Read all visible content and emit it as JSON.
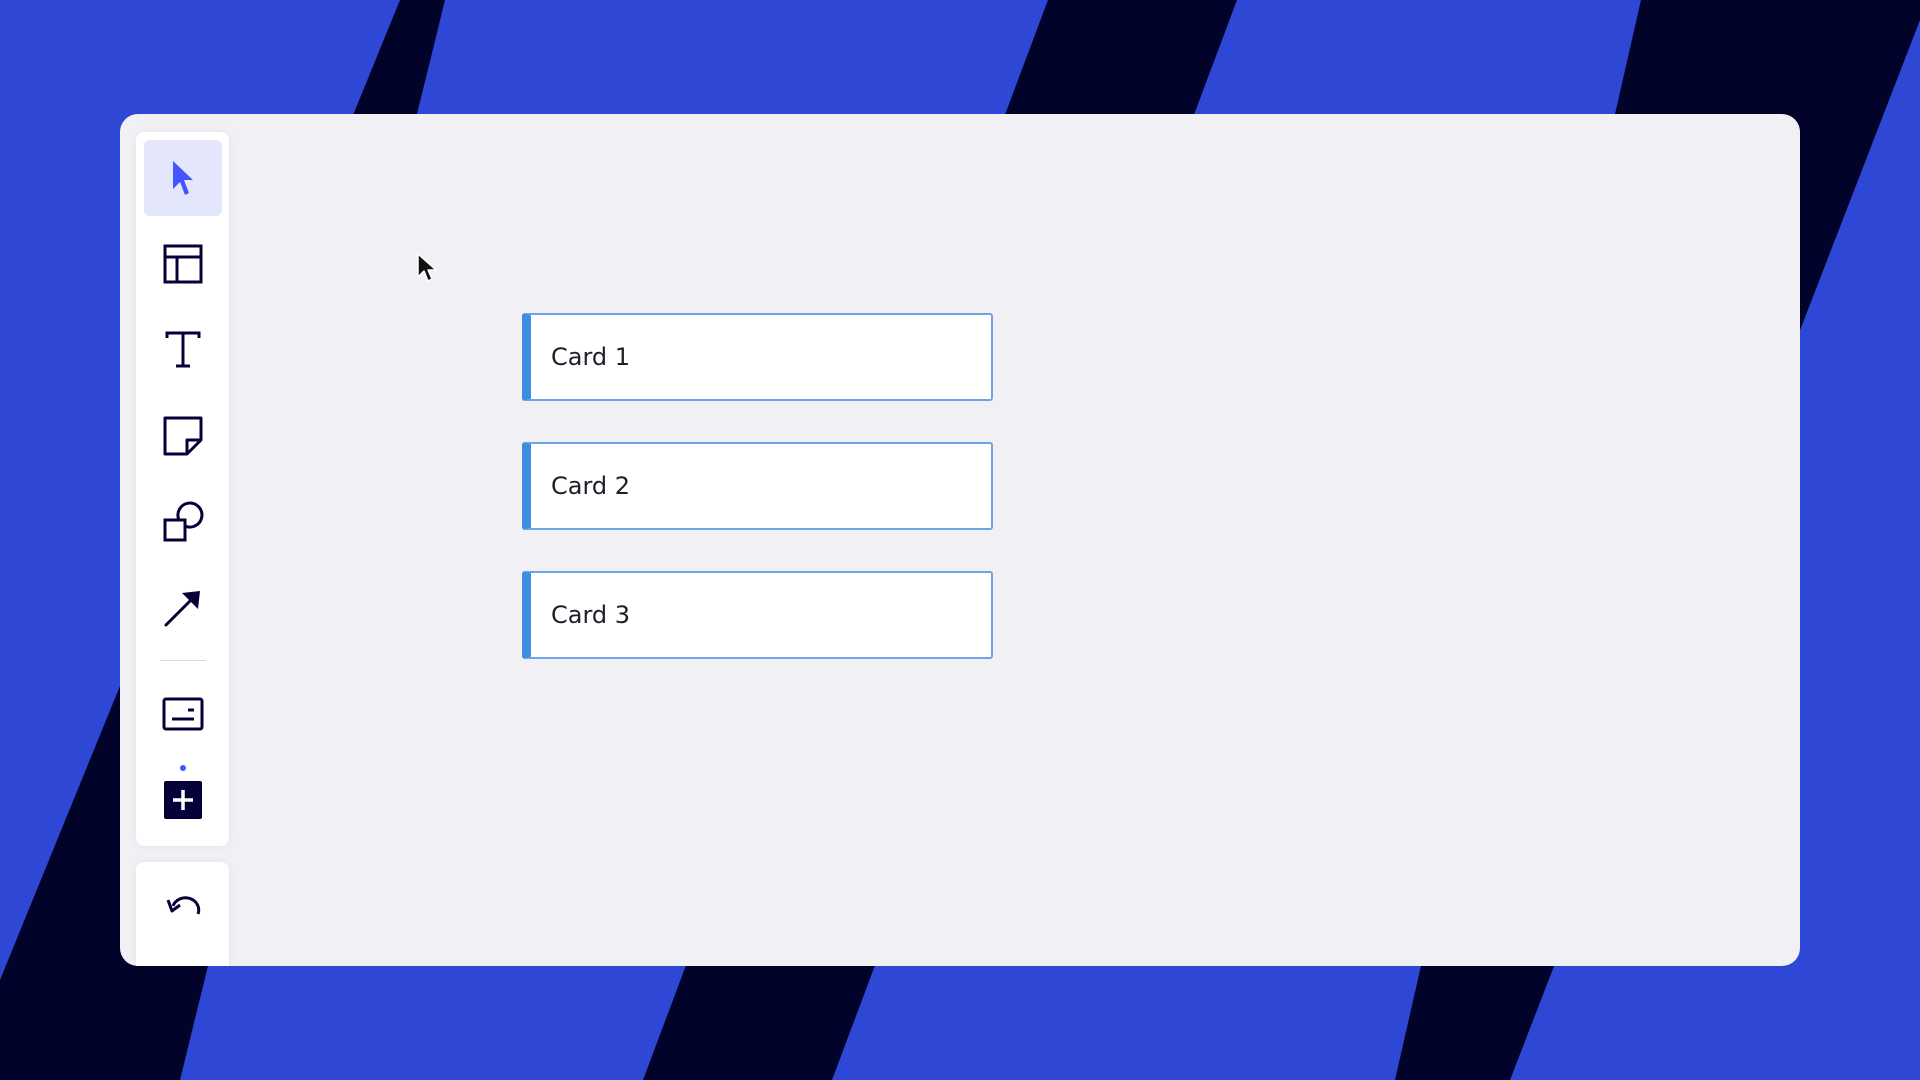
{
  "colors": {
    "background_primary": "#2e47d4",
    "background_stripe": "#02032b",
    "canvas": "#f1f1f5",
    "accent": "#4255ff",
    "card_border": "#6ba5e8",
    "card_accent": "#3d8de0"
  },
  "toolbar": {
    "tools": [
      {
        "name": "select",
        "icon": "cursor-arrow-icon",
        "active": true
      },
      {
        "name": "frame",
        "icon": "layout-frame-icon",
        "active": false
      },
      {
        "name": "text",
        "icon": "text-t-icon",
        "active": false
      },
      {
        "name": "sticky-note",
        "icon": "sticky-note-icon",
        "active": false
      },
      {
        "name": "shapes",
        "icon": "shapes-icon",
        "active": false
      },
      {
        "name": "connection-line",
        "icon": "arrow-line-icon",
        "active": false
      },
      {
        "name": "card",
        "icon": "card-template-icon",
        "active": false
      },
      {
        "name": "apps",
        "icon": "add-apps-icon",
        "active": false,
        "has_notification_dot": true
      }
    ],
    "undo": {
      "icon": "undo-icon"
    }
  },
  "canvas": {
    "cards": [
      {
        "label": "Card 1"
      },
      {
        "label": "Card 2"
      },
      {
        "label": "Card 3"
      }
    ]
  }
}
